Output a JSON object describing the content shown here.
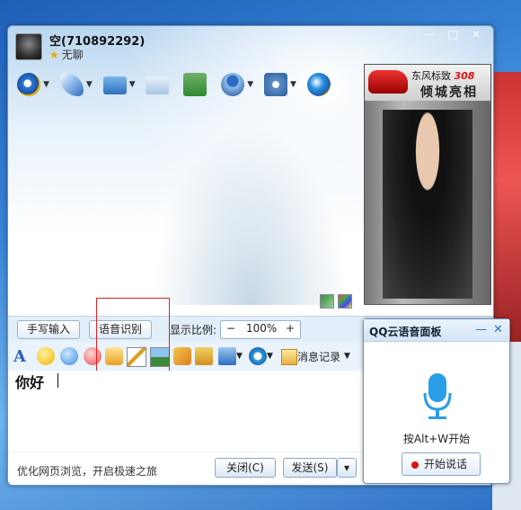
{
  "contact": {
    "name": "空(710892292)",
    "status": "无聊"
  },
  "ad": {
    "line1": "东风标致",
    "line1_num": "308",
    "line2": "倾城亮相"
  },
  "panel_buttons": {
    "handwriting": "手写输入",
    "voice_recog": "语音识别"
  },
  "zoom": {
    "label": "显示比例:",
    "minus": "−",
    "value": "100%",
    "plus": "+"
  },
  "format_bar": {
    "history": "消息记录"
  },
  "editor": {
    "text": "你好"
  },
  "footer": {
    "tip": "优化网页浏览，开启极速之旅",
    "close": "关闭(C)",
    "send": "发送(S)",
    "send_more": "▾"
  },
  "voice_panel": {
    "title": "QQ云语音面板",
    "hint": "按Alt+W开始",
    "start": "开始说话"
  },
  "window": {
    "min": "—",
    "max": "□",
    "close": "✕"
  }
}
